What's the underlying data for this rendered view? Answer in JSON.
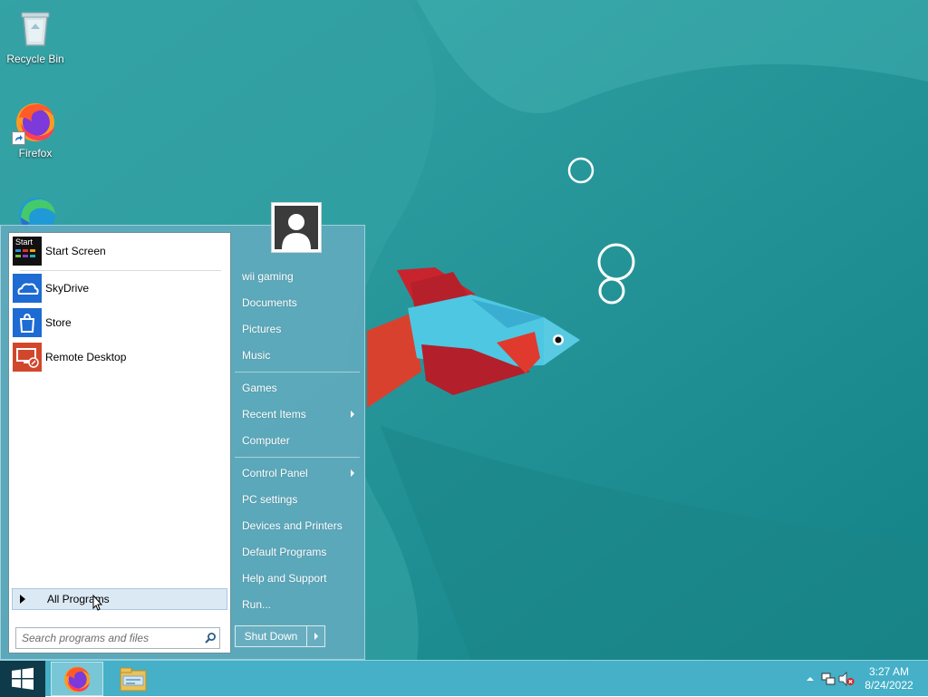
{
  "desktop": {
    "icons": [
      {
        "label": "Recycle Bin"
      },
      {
        "label": "Firefox"
      },
      {
        "label": "Microsoft Edge"
      }
    ]
  },
  "start_menu": {
    "pinned": [
      {
        "label": "Start Screen",
        "tile_text": "Start",
        "icon": "start-screen-icon"
      },
      {
        "label": "SkyDrive",
        "icon": "skydrive-icon"
      },
      {
        "label": "Store",
        "icon": "store-icon"
      },
      {
        "label": "Remote Desktop",
        "icon": "remote-desktop-icon"
      }
    ],
    "all_programs": "All Programs",
    "search_placeholder": "Search programs and files",
    "right_items": [
      {
        "label": "wii gaming"
      },
      {
        "label": "Documents"
      },
      {
        "label": "Pictures"
      },
      {
        "label": "Music"
      },
      {
        "label": "Games"
      },
      {
        "label": "Recent Items",
        "submenu": true
      },
      {
        "label": "Computer"
      },
      {
        "label": "Control Panel",
        "submenu": true
      },
      {
        "label": "PC settings"
      },
      {
        "label": "Devices and Printers"
      },
      {
        "label": "Default Programs"
      },
      {
        "label": "Help and Support"
      },
      {
        "label": "Run..."
      }
    ],
    "shutdown": "Shut Down"
  },
  "taskbar": {
    "pinned": [
      {
        "name": "firefox",
        "active": true
      },
      {
        "name": "file-explorer",
        "active": false
      }
    ],
    "clock": {
      "time": "3:27 AM",
      "date": "8/24/2022"
    }
  },
  "colors": {
    "desktop": "#1d8f92",
    "taskbar": "#45b0c7",
    "start_menu": "#62aabe"
  }
}
